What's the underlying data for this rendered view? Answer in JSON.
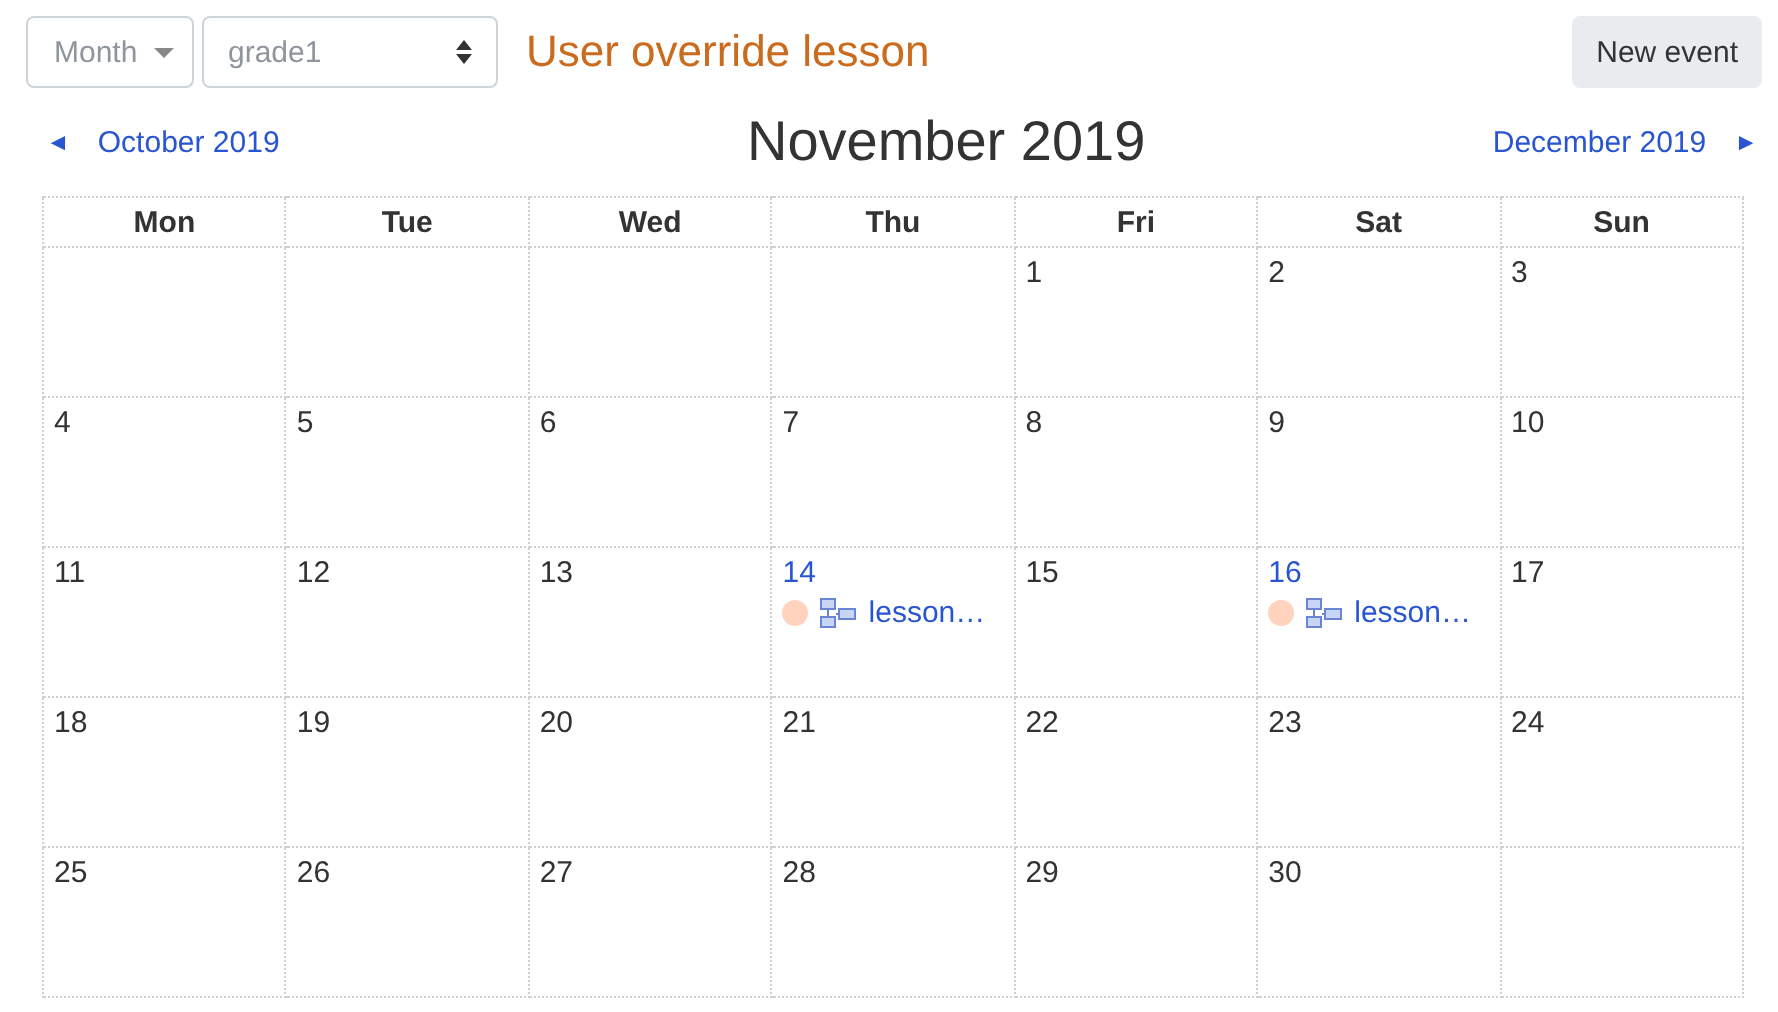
{
  "view_select": {
    "value": "Month"
  },
  "course_select": {
    "value": "grade1"
  },
  "heading": "User override lesson",
  "new_event_button": "New event",
  "nav": {
    "prev_arrow": "◄",
    "prev": "October 2019",
    "current": "November 2019",
    "next": "December 2019",
    "next_arrow": "►"
  },
  "weekdays": [
    "Mon",
    "Tue",
    "Wed",
    "Thu",
    "Fri",
    "Sat",
    "Sun"
  ],
  "weeks": [
    [
      {
        "kind": "blank"
      },
      {
        "kind": "blank"
      },
      {
        "kind": "blank"
      },
      {
        "kind": "blank"
      },
      {
        "kind": "day",
        "day": "1"
      },
      {
        "kind": "day",
        "day": "2"
      },
      {
        "kind": "day",
        "day": "3"
      }
    ],
    [
      {
        "kind": "day",
        "day": "4"
      },
      {
        "kind": "day",
        "day": "5"
      },
      {
        "kind": "day",
        "day": "6"
      },
      {
        "kind": "day",
        "day": "7"
      },
      {
        "kind": "day",
        "day": "8"
      },
      {
        "kind": "day",
        "day": "9"
      },
      {
        "kind": "day",
        "day": "10"
      }
    ],
    [
      {
        "kind": "day",
        "day": "11"
      },
      {
        "kind": "day",
        "day": "12"
      },
      {
        "kind": "day",
        "day": "13"
      },
      {
        "kind": "day",
        "day": "14",
        "events": [
          {
            "title": "lesson…",
            "color": "#ffd3bd"
          }
        ]
      },
      {
        "kind": "day",
        "day": "15"
      },
      {
        "kind": "day",
        "day": "16",
        "events": [
          {
            "title": "lesson…",
            "color": "#ffd3bd"
          }
        ]
      },
      {
        "kind": "day",
        "day": "17"
      }
    ],
    [
      {
        "kind": "day",
        "day": "18"
      },
      {
        "kind": "day",
        "day": "19"
      },
      {
        "kind": "day",
        "day": "20"
      },
      {
        "kind": "day",
        "day": "21"
      },
      {
        "kind": "day",
        "day": "22"
      },
      {
        "kind": "day",
        "day": "23"
      },
      {
        "kind": "day",
        "day": "24"
      }
    ],
    [
      {
        "kind": "day",
        "day": "25"
      },
      {
        "kind": "day",
        "day": "26"
      },
      {
        "kind": "day",
        "day": "27"
      },
      {
        "kind": "day",
        "day": "28"
      },
      {
        "kind": "day",
        "day": "29"
      },
      {
        "kind": "day",
        "day": "30"
      },
      {
        "kind": "blank"
      }
    ]
  ]
}
